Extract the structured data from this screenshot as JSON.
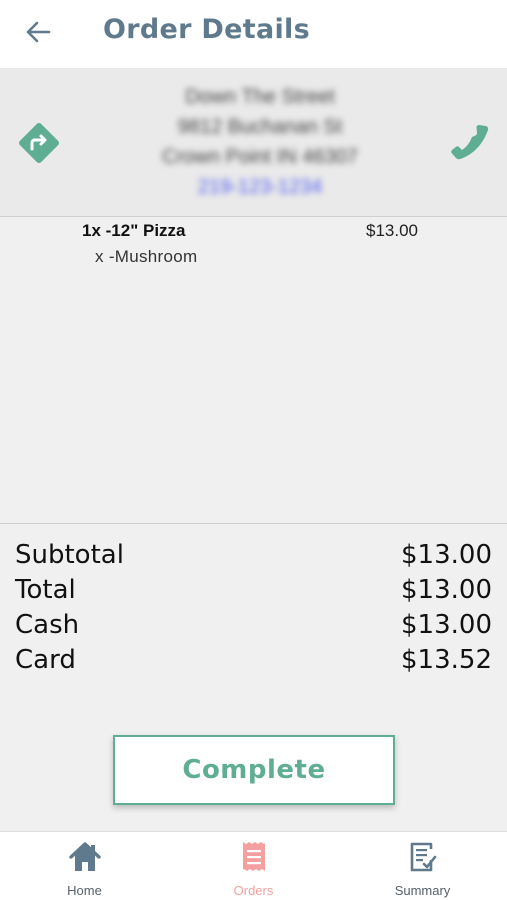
{
  "header": {
    "title": "Order Details"
  },
  "customer": {
    "name": "Down The Street",
    "street": "9812 Buchanan St",
    "city": "Crown Point IN 46307",
    "phone": "219-123-1234"
  },
  "items": [
    {
      "name": "1x -12\" Pizza",
      "price": "$13.00",
      "modifiers": [
        "x -Mushroom"
      ]
    }
  ],
  "totals": {
    "subtotal_label": "Subtotal",
    "subtotal_value": "$13.00",
    "total_label": "Total",
    "total_value": "$13.00",
    "cash_label": "Cash",
    "cash_value": "$13.00",
    "card_label": "Card",
    "card_value": "$13.52"
  },
  "actions": {
    "complete_label": "Complete"
  },
  "nav": {
    "home_label": "Home",
    "orders_label": "Orders",
    "summary_label": "Summary",
    "active": "orders"
  },
  "colors": {
    "accent": "#5fae93",
    "title": "#5e7a8c",
    "active_nav": "#f5a0a0",
    "phone_link": "#4d5cf0"
  },
  "icons": {
    "back": "arrow-left-icon",
    "directions": "directions-icon",
    "call": "phone-icon",
    "home": "home-icon",
    "orders": "receipt-icon",
    "summary": "summary-checklist-icon"
  }
}
